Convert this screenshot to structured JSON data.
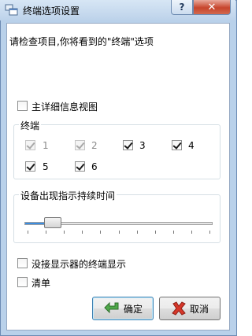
{
  "window": {
    "title": "终端选项设置",
    "help_label": "?",
    "close_label": "✕"
  },
  "intro_text": "请检查项目,你将看到的\"终端\"选项",
  "detail_view": {
    "label": "主详细信息视图",
    "checked": false
  },
  "terminals": {
    "title": "终端",
    "items": [
      {
        "label": "1",
        "checked": true,
        "disabled": true
      },
      {
        "label": "2",
        "checked": true,
        "disabled": true
      },
      {
        "label": "3",
        "checked": true,
        "disabled": false
      },
      {
        "label": "4",
        "checked": true,
        "disabled": false
      },
      {
        "label": "5",
        "checked": true,
        "disabled": false
      },
      {
        "label": "6",
        "checked": true,
        "disabled": false
      }
    ]
  },
  "duration": {
    "title": "设备出现指示持续时间",
    "slider_value": 0.15
  },
  "no_display_terminal": {
    "label": "没接显示器的终端显示",
    "checked": false
  },
  "list_option": {
    "label": "清单",
    "checked": false
  },
  "buttons": {
    "ok": "确定",
    "cancel": "取消"
  },
  "colors": {
    "accent": "#3b8de0",
    "close": "#c7452c"
  }
}
